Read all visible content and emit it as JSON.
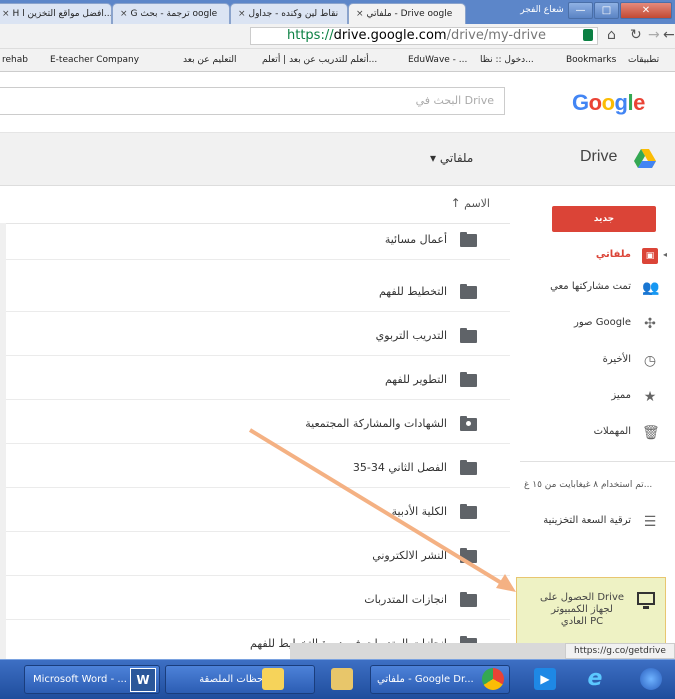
{
  "browser": {
    "tabs": [
      {
        "label": "H  افضل مواقع التخزين ا...",
        "active": false
      },
      {
        "label": "G  ترجمة - بحث oogle",
        "active": false
      },
      {
        "label": "نقاط لين وكنده - جداول",
        "active": false
      },
      {
        "label": "ملفاتي - Drive oogle",
        "active": true
      }
    ],
    "window_title": "شعاع الفجر",
    "url_scheme": "https://",
    "url_host": "drive.google.com",
    "url_path": "/drive/my-drive",
    "bookmarks": [
      "تطبيقات",
      "Bookmarks",
      "دخول :: نظا...",
      "EduWave - ...",
      "أتعلم للتدريب عن بعد | أتعلم...",
      "التعليم عن بعد",
      "E-teacher Company",
      "rehab"
    ]
  },
  "google": {
    "search_placeholder": "البحث في Drive"
  },
  "drive": {
    "title": "Drive",
    "my_drive_menu": "ملفاتي",
    "column_name": "الاسم",
    "files": [
      {
        "name": "أعمال مسائية",
        "shared": false
      },
      {
        "name": "التخطيط للفهم",
        "shared": false
      },
      {
        "name": "التدريب التربوي",
        "shared": false
      },
      {
        "name": "التطوير للفهم",
        "shared": false
      },
      {
        "name": "الشهادات والمشاركة المجتمعية",
        "shared": true
      },
      {
        "name": "الفصل الثاني 34-35",
        "shared": false
      },
      {
        "name": "الكلية الأدبية",
        "shared": false
      },
      {
        "name": "النشر الالكتروني",
        "shared": false
      },
      {
        "name": "انجازات المتدربات",
        "shared": false
      },
      {
        "name": "انجازات المتدربات في دورة التخطيط للفهم",
        "shared": false
      }
    ],
    "new_button": "جديد",
    "nav": [
      {
        "label": "ملفاتي",
        "icon": "folder-icon",
        "active": true
      },
      {
        "label": "تمت مشاركتها معي",
        "icon": "people-icon",
        "active": false
      },
      {
        "label": "صور Google",
        "icon": "photos-icon",
        "active": false
      },
      {
        "label": "الأخيرة",
        "icon": "clock-icon",
        "active": false
      },
      {
        "label": "مميز",
        "icon": "star-icon",
        "active": false
      },
      {
        "label": "المهملات",
        "icon": "trash-icon",
        "active": false
      }
    ],
    "storage_text": "تم استخدام ٨ غيغابايت من ١٥ غ...",
    "upgrade_storage": "ترقية السعة التخزينية",
    "get_drive_text": "الحصول على Drive لجهاز الكمبيوتر العادي PC",
    "status_url": "https://g.co/getdrive"
  },
  "taskbar": {
    "items": [
      {
        "label": "Microsoft Word - ..."
      },
      {
        "label": "الملاحظات الملصقة"
      },
      {
        "label": "ملفاتي - Google Dr..."
      }
    ]
  },
  "colors": {
    "accent_red": "#db4437",
    "arrow": "#f4b183"
  }
}
